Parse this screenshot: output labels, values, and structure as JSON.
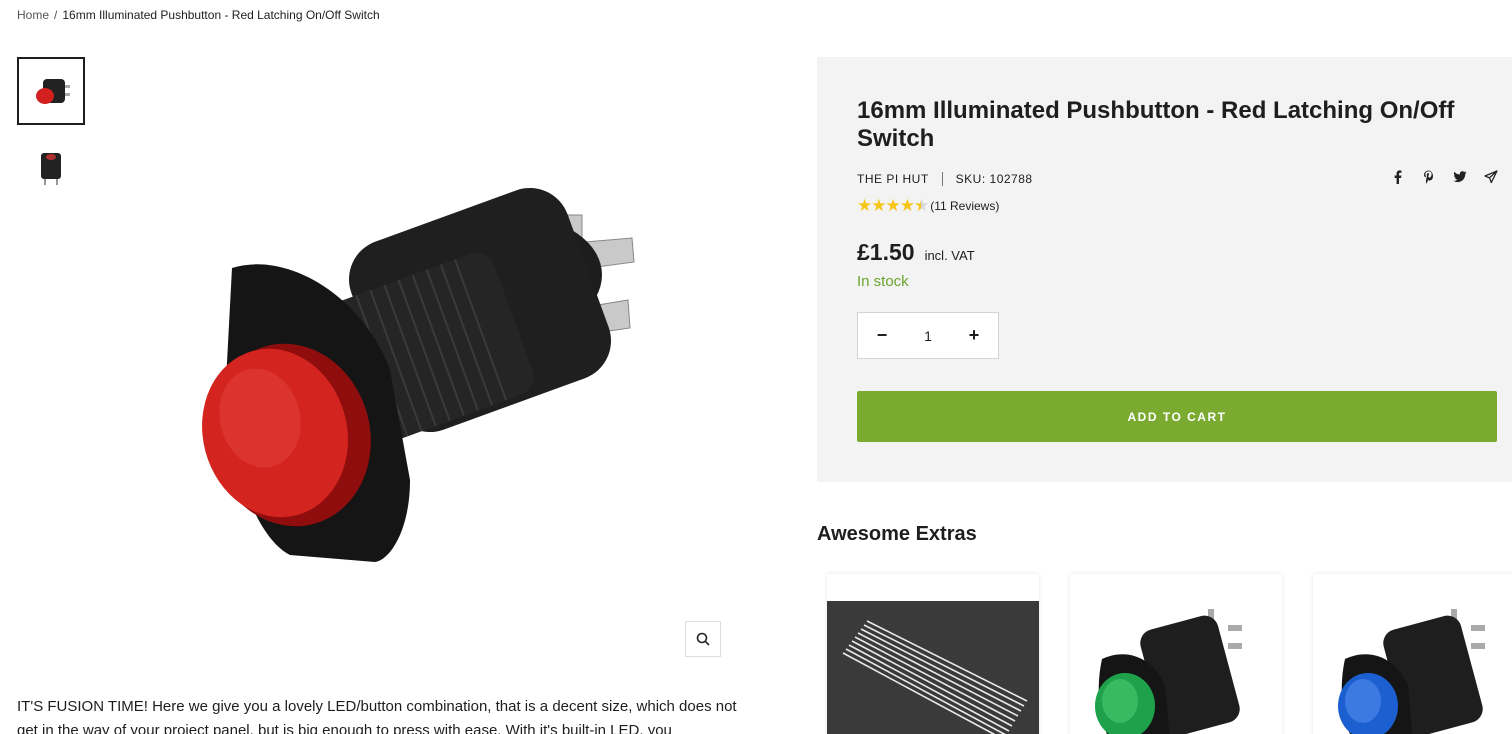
{
  "breadcrumb": {
    "home": "Home",
    "separator": "/",
    "current": "16mm Illuminated Pushbutton - Red Latching On/Off Switch"
  },
  "product": {
    "title": "16mm Illuminated Pushbutton - Red Latching On/Off Switch",
    "vendor": "THE PI HUT",
    "sku": "SKU: 102788",
    "rating": {
      "stars": "★★★★",
      "half_star": "★",
      "value": 4.5,
      "reviews": "(11 Reviews)"
    },
    "price": "£1.50",
    "vat_label": "incl. VAT",
    "stock": "In stock",
    "quantity": "1",
    "minus_label": "−",
    "plus_label": "+",
    "add_to_cart": "ADD TO CART"
  },
  "thumbnails": [
    {
      "icon": "red-pushbutton-thumbnail"
    },
    {
      "icon": "pushbutton-side-thumbnail"
    }
  ],
  "share_icons": [
    "facebook-icon",
    "pinterest-icon",
    "twitter-icon",
    "email-icon"
  ],
  "description": "IT'S FUSION TIME! Here we give you a lovely LED/button combination, that is a decent size, which does not get in the way of your project panel, but is big enough to press with ease. With it's built-in LED, you",
  "extras": {
    "title": "Awesome Extras",
    "items": [
      {
        "icon": "jumper-wires-image"
      },
      {
        "icon": "green-pushbutton-image"
      },
      {
        "icon": "blue-pushbutton-image"
      }
    ]
  },
  "colors": {
    "accent": "#7aab30",
    "stock": "#6aa42f",
    "star": "#f5c518",
    "panel": "#f3f3f3"
  }
}
